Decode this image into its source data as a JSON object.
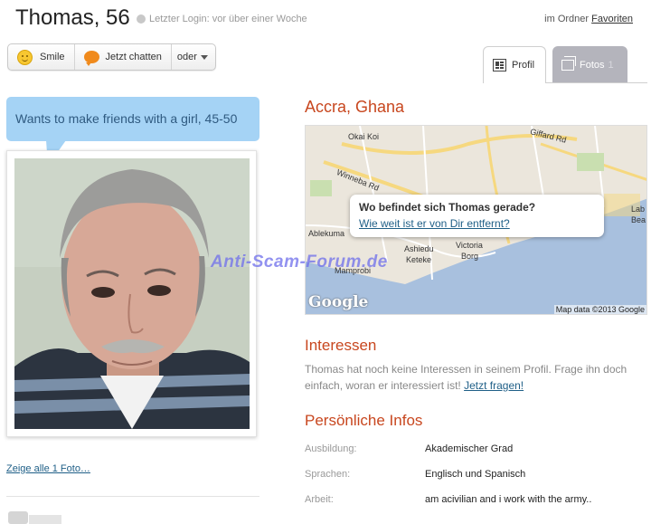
{
  "header": {
    "name": "Thomas, 56",
    "last_login": "Letzter Login: vor über einer Woche",
    "folder_prefix": "im Ordner",
    "folder_link": "Favoriten"
  },
  "actions": {
    "smile_label": "Smile",
    "chat_label": "Jetzt chatten",
    "more_label": "oder"
  },
  "tabs": {
    "profil_label": "Profil",
    "fotos_label": "Fotos",
    "fotos_count": "1"
  },
  "bubble_text": "Wants to make friends with a girl, 45-50",
  "photos_link": "Zeige alle 1 Foto…",
  "location": "Accra, Ghana",
  "map": {
    "popup_question": "Wo befindet sich Thomas gerade?",
    "popup_link": "Wie weit ist er von Dir entfernt?",
    "labels": {
      "okai_koi": "Okai Koi",
      "giffard": "Giffard Rd",
      "winneba": "Winneba Rd",
      "ablekuma": "Ablekuma",
      "ashiedu": "Ashiedu",
      "keteke": "Keteke",
      "victoria": "Victoria",
      "borg": "Borg",
      "mamprobi": "Mamprobi",
      "lab": "Lab",
      "bea": "Bea"
    },
    "google": "Google",
    "attribution": "Map data ©2013 Google"
  },
  "watermark": "Anti-Scam-Forum.de",
  "interests": {
    "title": "Interessen",
    "text": "Thomas hat noch keine Interessen in seinem Profil. Frage ihn doch einfach, woran er interessiert ist!",
    "link": "Jetzt fragen!"
  },
  "personal": {
    "title": "Persönliche Infos",
    "rows": [
      {
        "label": "Ausbildung:",
        "value": "Akademischer Grad"
      },
      {
        "label": "Sprachen:",
        "value": "Englisch und Spanisch"
      },
      {
        "label": "Arbeit:",
        "value": "am acivilian and i work with the army.."
      }
    ]
  }
}
